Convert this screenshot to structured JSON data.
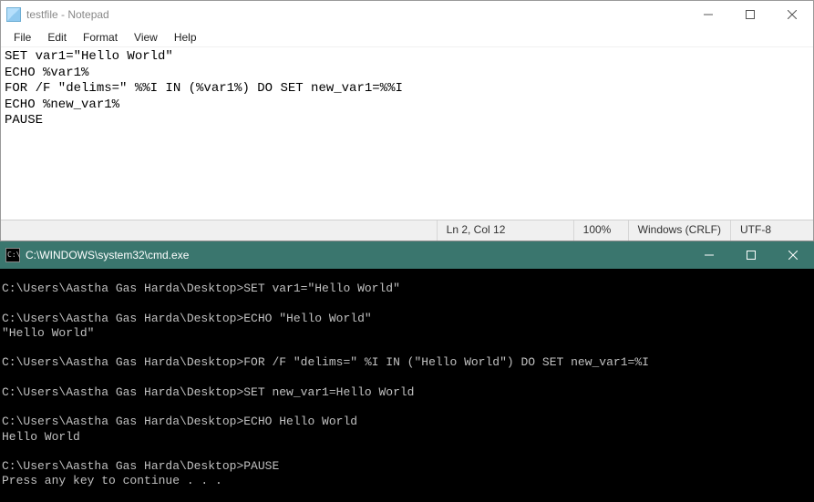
{
  "notepad": {
    "title": "testfile - Notepad",
    "menu": {
      "file": "File",
      "edit": "Edit",
      "format": "Format",
      "view": "View",
      "help": "Help"
    },
    "content": "SET var1=\"Hello World\"\nECHO %var1%\nFOR /F \"delims=\" %%I IN (%var1%) DO SET new_var1=%%I\nECHO %new_var1%\nPAUSE",
    "status": {
      "cursor": "Ln 2, Col 12",
      "zoom": "100%",
      "lineending": "Windows (CRLF)",
      "encoding": "UTF-8"
    }
  },
  "cmd": {
    "title": "C:\\WINDOWS\\system32\\cmd.exe",
    "output": "C:\\Users\\Aastha Gas Harda\\Desktop>SET var1=\"Hello World\"\n\nC:\\Users\\Aastha Gas Harda\\Desktop>ECHO \"Hello World\"\n\"Hello World\"\n\nC:\\Users\\Aastha Gas Harda\\Desktop>FOR /F \"delims=\" %I IN (\"Hello World\") DO SET new_var1=%I\n\nC:\\Users\\Aastha Gas Harda\\Desktop>SET new_var1=Hello World\n\nC:\\Users\\Aastha Gas Harda\\Desktop>ECHO Hello World\nHello World\n\nC:\\Users\\Aastha Gas Harda\\Desktop>PAUSE\nPress any key to continue . . ."
  }
}
